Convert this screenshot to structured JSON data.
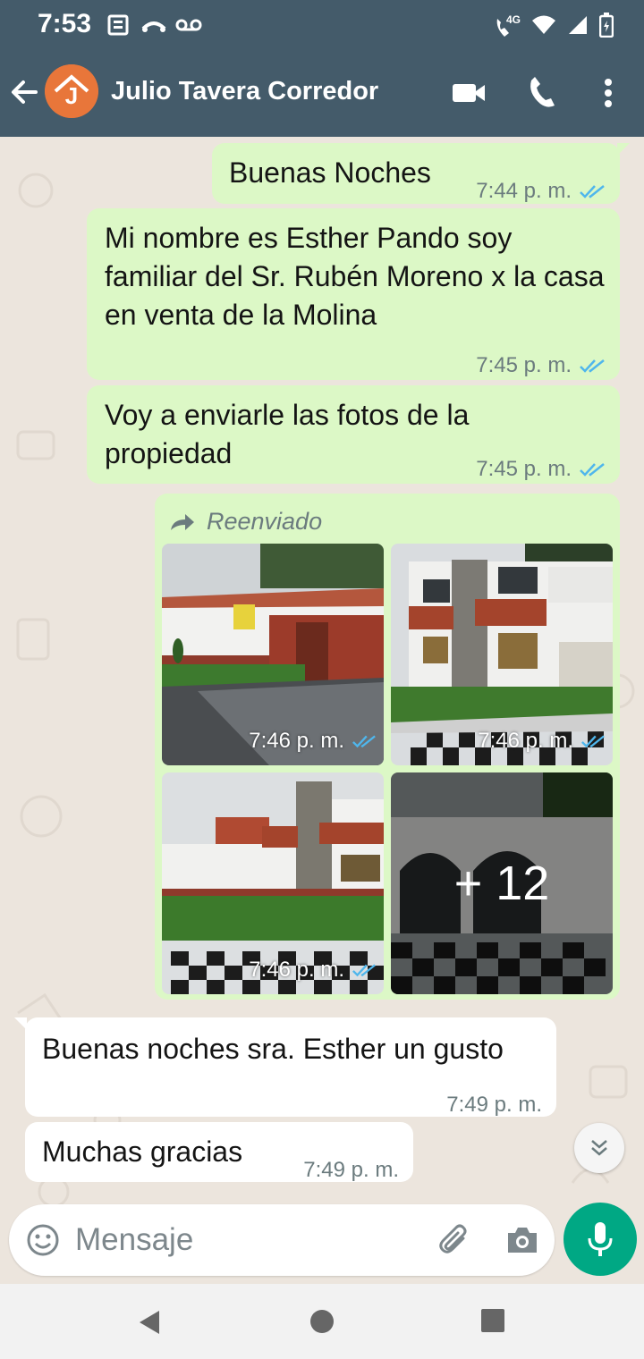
{
  "status": {
    "time": "7:53",
    "network": "4G"
  },
  "header": {
    "contact_name": "Julio Tavera Corredor",
    "avatar_letter": "J"
  },
  "messages": [
    {
      "text": "Buenas Noches",
      "time": "7:44 p. m."
    },
    {
      "text": "Mi nombre es Esther Pando soy familiar del Sr. Rubén Moreno x la casa en venta de la Molina",
      "time": "7:45 p. m."
    },
    {
      "text": "Voy a enviarle las fotos de la propiedad",
      "time": "7:45 p. m."
    },
    {
      "forwarded_label": "Reenviado",
      "photos": [
        {
          "time": "7:46 p. m."
        },
        {
          "time": "7:46 p. m."
        },
        {
          "time": "7:46 p. m."
        },
        {
          "more": "+ 12"
        }
      ]
    },
    {
      "text": "Buenas noches sra. Esther un gusto",
      "time": "7:49 p. m."
    },
    {
      "text": "Muchas gracias",
      "time": "7:49 p. m."
    }
  ],
  "composer": {
    "placeholder": "Mensaje"
  },
  "colors": {
    "header": "#445b6a",
    "outgoing": "#dcf8c6",
    "incoming": "#ffffff",
    "read_tick": "#4fb6ec",
    "mic": "#00a884"
  }
}
